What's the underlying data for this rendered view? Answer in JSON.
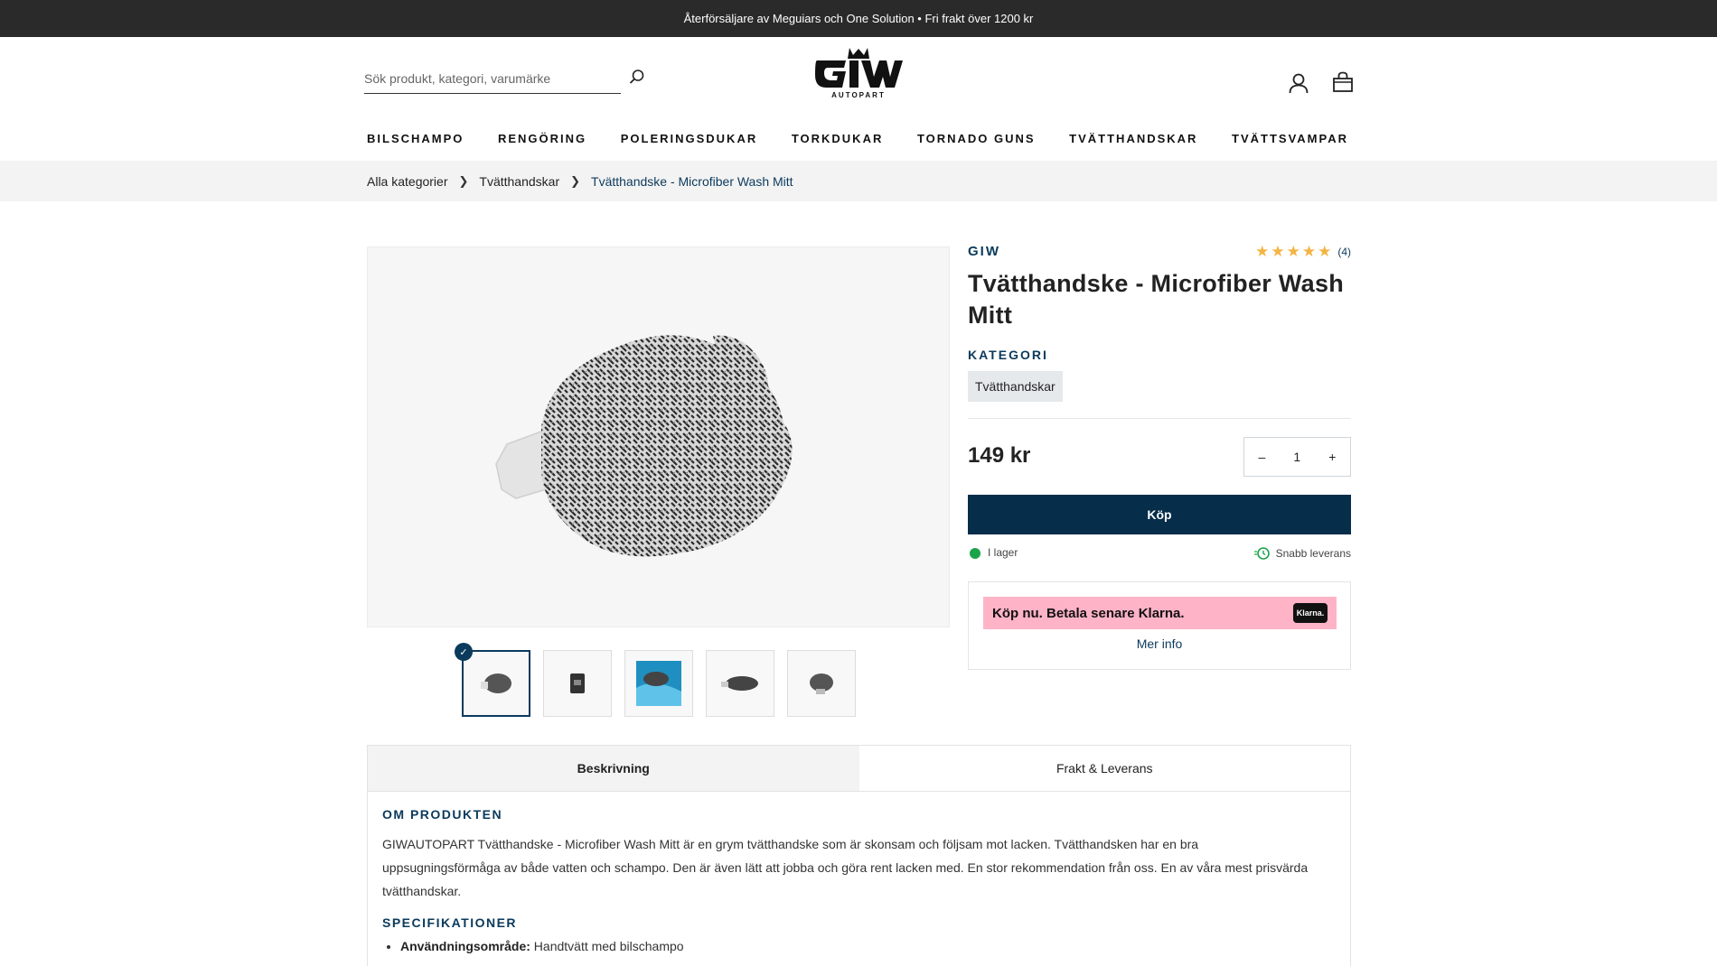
{
  "announcement": "Återförsäljare av Meguiars och One Solution • Fri frakt över 1200 kr",
  "header": {
    "search_placeholder": "Sök produkt, kategori, varumärke",
    "logo_text": "GIW",
    "logo_subtext": "AUTOPART"
  },
  "nav": [
    "BILSCHAMPO",
    "RENGÖRING",
    "POLERINGSDUKAR",
    "TORKDUKAR",
    "TORNADO GUNS",
    "TVÄTTHANDSKAR",
    "TVÄTTSVAMPAR"
  ],
  "breadcrumb": {
    "items": [
      "Alla kategorier",
      "Tvätthandskar"
    ],
    "current": "Tvätthandske - Microfiber Wash Mitt"
  },
  "gallery": {
    "thumbnail_count": 5,
    "selected_index": 0
  },
  "product": {
    "brand": "GIW",
    "rating_count": "(4)",
    "rating_stars": 5,
    "title": "Tvätthandske - Microfiber Wash Mitt",
    "category_label": "KATEGORI",
    "category": "Tvätthandskar",
    "price": "149 kr",
    "qty_minus": "–",
    "qty_value": "1",
    "qty_plus": "+",
    "buy_label": "Köp",
    "stock": "I lager",
    "delivery": "Snabb leverans"
  },
  "klarna": {
    "text": "Köp nu. Betala senare Klarna.",
    "logo": "Klarna.",
    "more_info": "Mer info"
  },
  "tabs": [
    "Beskrivning",
    "Frakt & Leverans"
  ],
  "description": {
    "heading": "OM PRODUKTEN",
    "body": "GIWAUTOPART Tvätthandske - Microfiber Wash Mitt är en grym tvätthandske som är skonsam och följsam mot lacken. Tvätthandsken har en bra uppsugningsförmåga av både vatten och schampo. Den är även lätt att jobba och göra rent lacken med. En stor rekommendation från oss. En av våra mest prisvärda tvätthandskar.",
    "spec_heading": "SPECIFIKATIONER",
    "spec_label": "Användningsområde:",
    "spec_value": "Handtvätt med bilschampo"
  },
  "colors": {
    "primary": "#062d4a",
    "accent_text": "#0b3a5c",
    "star": "#f3b443",
    "klarna": "#ffb3c7",
    "stock": "#1aa34a"
  }
}
